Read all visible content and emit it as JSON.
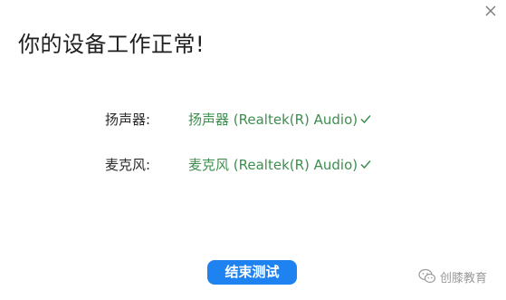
{
  "dialog": {
    "title": "你的设备工作正常!"
  },
  "devices": {
    "speaker": {
      "label": "扬声器:",
      "name": "扬声器 (Realtek(R) Audio)",
      "status_icon": "checkmark-icon"
    },
    "microphone": {
      "label": "麦克风:",
      "name": "麦克风 (Realtek(R) Audio)",
      "status_icon": "checkmark-icon"
    }
  },
  "actions": {
    "end_test_label": "结束测试"
  },
  "watermark": {
    "text": "创膝教育"
  },
  "colors": {
    "accent": "#1e82f0",
    "device_text": "#3d8e4f",
    "check": "#3d8e4f"
  }
}
